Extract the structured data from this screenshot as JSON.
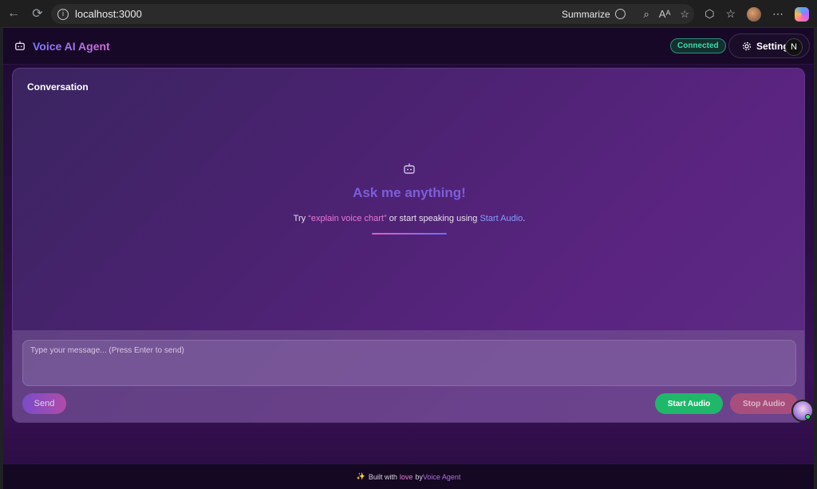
{
  "browser": {
    "url": "localhost:3000",
    "summarize_label": "Summarize"
  },
  "header": {
    "title": "Voice AI Agent",
    "status": "Connected",
    "settings_label": "Settings",
    "user_initial": "N"
  },
  "conversation": {
    "title": "Conversation",
    "empty_title": "Ask me anything!",
    "hint_prefix": "Try ",
    "hint_example": "“explain voice chart”",
    "hint_middle": " or start speaking using ",
    "hint_action": "Start Audio",
    "hint_suffix": "."
  },
  "composer": {
    "placeholder": "Type your message... (Press Enter to send)",
    "send_label": "Send",
    "start_audio_label": "Start Audio",
    "stop_audio_label": "Stop Audio"
  },
  "footer": {
    "sparkle": "✨",
    "prefix": "Built with",
    "love": "love",
    "by": "by",
    "brand": "Voice Agent"
  },
  "colors": {
    "accent": "#7a5fd8",
    "connected": "#43d6a8",
    "start_audio": "#1fb86a",
    "stop_audio": "#a84e7c"
  }
}
